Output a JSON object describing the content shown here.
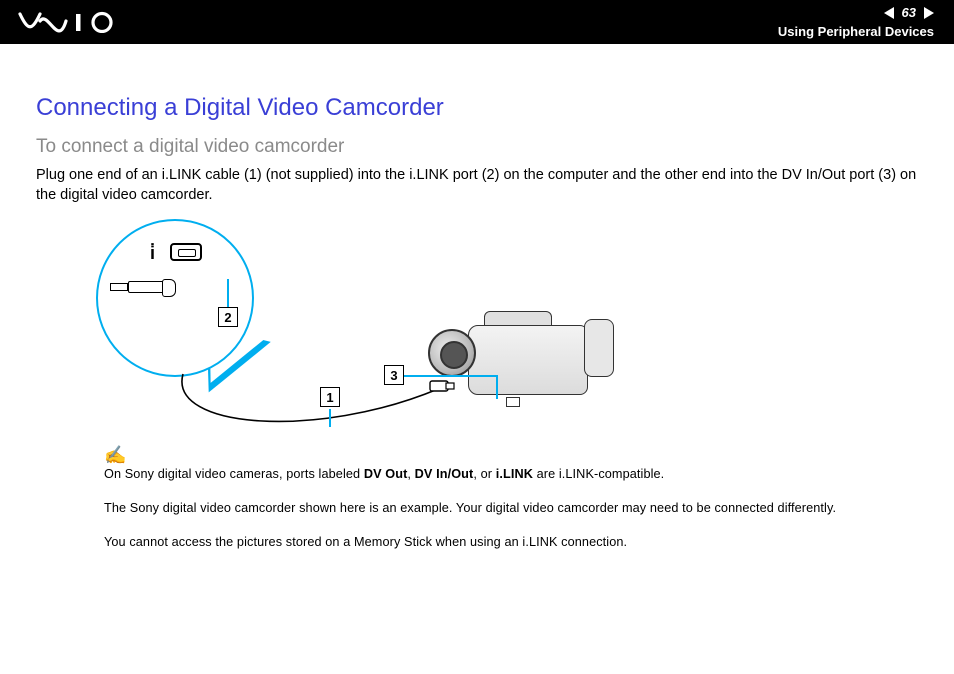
{
  "header": {
    "page_number": "63",
    "section": "Using Peripheral Devices",
    "logo_alt": "VAIO"
  },
  "title": "Connecting a Digital Video Camcorder",
  "subtitle": "To connect a digital video camcorder",
  "instruction": "Plug one end of an i.LINK cable (1) (not supplied) into the i.LINK port (2) on the computer and the other end into the DV In/Out port (3) on the digital video camcorder.",
  "diagram": {
    "label_1": "1",
    "label_2": "2",
    "label_3": "3",
    "callout_icon_name": "i.LINK"
  },
  "notes": {
    "icon_glyph": "✍",
    "line1_pre": "On Sony digital video cameras, ports labeled ",
    "line1_b1": "DV Out",
    "line1_mid1": ", ",
    "line1_b2": "DV In/Out",
    "line1_mid2": ", or ",
    "line1_b3": "i.LINK",
    "line1_post": " are i.LINK-compatible.",
    "line2": "The Sony digital video camcorder shown here is an example. Your digital video camcorder may need to be connected differently.",
    "line3": "You cannot access the pictures stored on a Memory Stick when using an i.LINK connection."
  }
}
